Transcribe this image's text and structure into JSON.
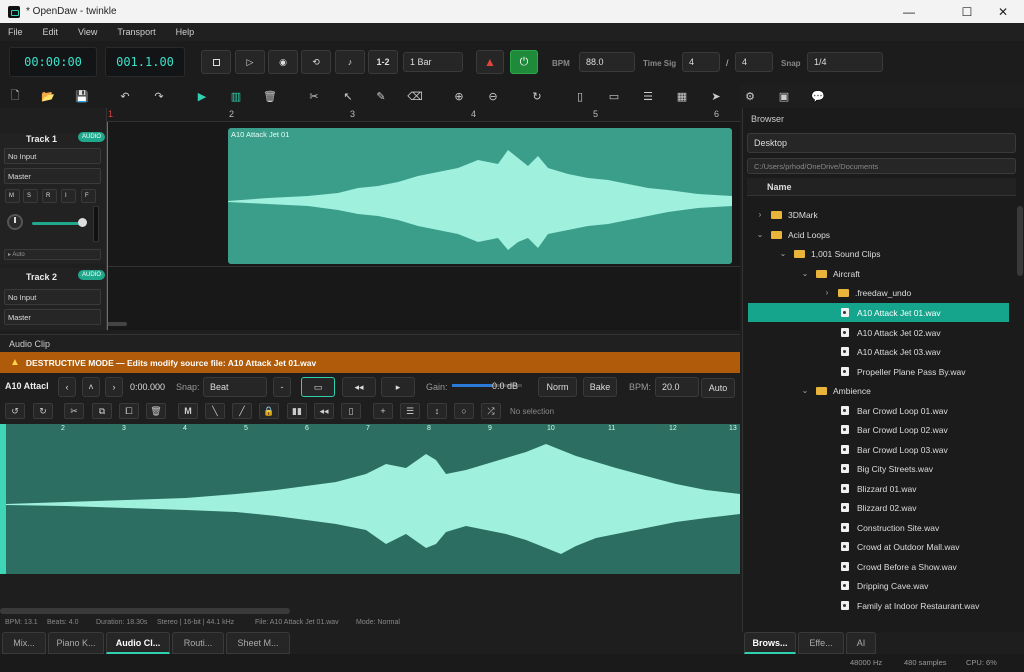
{
  "window": {
    "title": "* OpenDaw - twinkle",
    "minimize": "—",
    "maximize": "☐",
    "close": "✕"
  },
  "menu": [
    "File",
    "Edit",
    "View",
    "Transport",
    "Help"
  ],
  "transport": {
    "time": "00:00:00",
    "bars": "001.1.00",
    "loop_label": "1-2",
    "loop_length": "1 Bar",
    "bpm_label": "BPM",
    "bpm": "88.0",
    "timesig_label": "Time Sig",
    "timesig_num": "4",
    "timesig_sep": "/",
    "timesig_den": "4",
    "snap_label": "Snap",
    "snap": "1/4"
  },
  "tracks": [
    {
      "name": "Track 1",
      "badge": "AUDIO",
      "input": "No Input",
      "output": "Master",
      "buttons": [
        "M",
        "S",
        "R",
        "I",
        "F"
      ],
      "auto": "▸ Auto"
    },
    {
      "name": "Track 2",
      "badge": "AUDIO",
      "input": "No Input",
      "output": "Master"
    }
  ],
  "ruler": [
    "1",
    "2",
    "3",
    "4",
    "5",
    "6"
  ],
  "clip": {
    "name": "A10 Attack Jet 01"
  },
  "clip_panel": {
    "title": "Audio Clip",
    "warning": "DESTRUCTIVE MODE — Edits modify source file: A10 Attack Jet 01.wav",
    "clip_name": "A10 Attacl",
    "position": "0:00.000",
    "snap_label": "Snap:",
    "snap": "Beat",
    "gain_label": "Gain:",
    "gain": "0.0 dB",
    "norm": "Norm",
    "bake": "Bake",
    "bpm_label": "BPM:",
    "bpm": "20.0",
    "auto": "Auto",
    "selection": "No selection",
    "ruler": [
      "2",
      "3",
      "4",
      "5",
      "6",
      "7",
      "8",
      "9",
      "10",
      "11",
      "12",
      "13"
    ],
    "status": {
      "bpm": "BPM: 13.1",
      "beats": "Beats: 4.0",
      "duration": "Duration: 18.30s",
      "format": "Stereo | 16-bit | 44.1 kHz",
      "file": "File: A10 Attack Jet 01.wav",
      "mode": "Mode: Normal"
    }
  },
  "bottom_tabs": [
    "Mix...",
    "Piano K...",
    "Audio Cl...",
    "Routi...",
    "Sheet M..."
  ],
  "browser": {
    "title": "Browser",
    "location": "Desktop",
    "path": "C:/Users/prhod/OneDrive/Documents",
    "column": "Name",
    "tabs": [
      "Brows...",
      "Effe...",
      "AI"
    ],
    "items": [
      {
        "label": "3DMark",
        "type": "folder",
        "expanded": false
      },
      {
        "label": "Acid Loops",
        "type": "folder",
        "expanded": true
      },
      {
        "label": "1,001 Sound Clips",
        "type": "folder",
        "expanded": true
      },
      {
        "label": "Aircraft",
        "type": "folder",
        "expanded": true
      },
      {
        "label": ".freedaw_undo",
        "type": "folder",
        "expanded": false
      },
      {
        "label": "A10 Attack Jet 01.wav",
        "type": "file",
        "selected": true
      },
      {
        "label": "A10 Attack Jet 02.wav",
        "type": "file"
      },
      {
        "label": "A10 Attack Jet 03.wav",
        "type": "file"
      },
      {
        "label": "Propeller Plane Pass By.wav",
        "type": "file"
      },
      {
        "label": "Ambience",
        "type": "folder",
        "expanded": true
      },
      {
        "label": "Bar Crowd Loop 01.wav",
        "type": "file"
      },
      {
        "label": "Bar Crowd Loop 02.wav",
        "type": "file"
      },
      {
        "label": "Bar Crowd Loop 03.wav",
        "type": "file"
      },
      {
        "label": "Big City Streets.wav",
        "type": "file"
      },
      {
        "label": "Blizzard 01.wav",
        "type": "file"
      },
      {
        "label": "Blizzard 02.wav",
        "type": "file"
      },
      {
        "label": "Construction Site.wav",
        "type": "file"
      },
      {
        "label": "Crowd at Outdoor Mall.wav",
        "type": "file"
      },
      {
        "label": "Crowd Before a Show.wav",
        "type": "file"
      },
      {
        "label": "Dripping Cave.wav",
        "type": "file"
      },
      {
        "label": "Family at Indoor Restaurant.wav",
        "type": "file"
      }
    ]
  },
  "status": {
    "rate": "48000 Hz",
    "buffer": "480 samples",
    "cpu": "CPU: 6%"
  },
  "colors": {
    "accent": "#2fb59c",
    "wave": "#9ff0dd",
    "clip_bg": "#3a9e8a",
    "warning": "#b05b0a"
  }
}
